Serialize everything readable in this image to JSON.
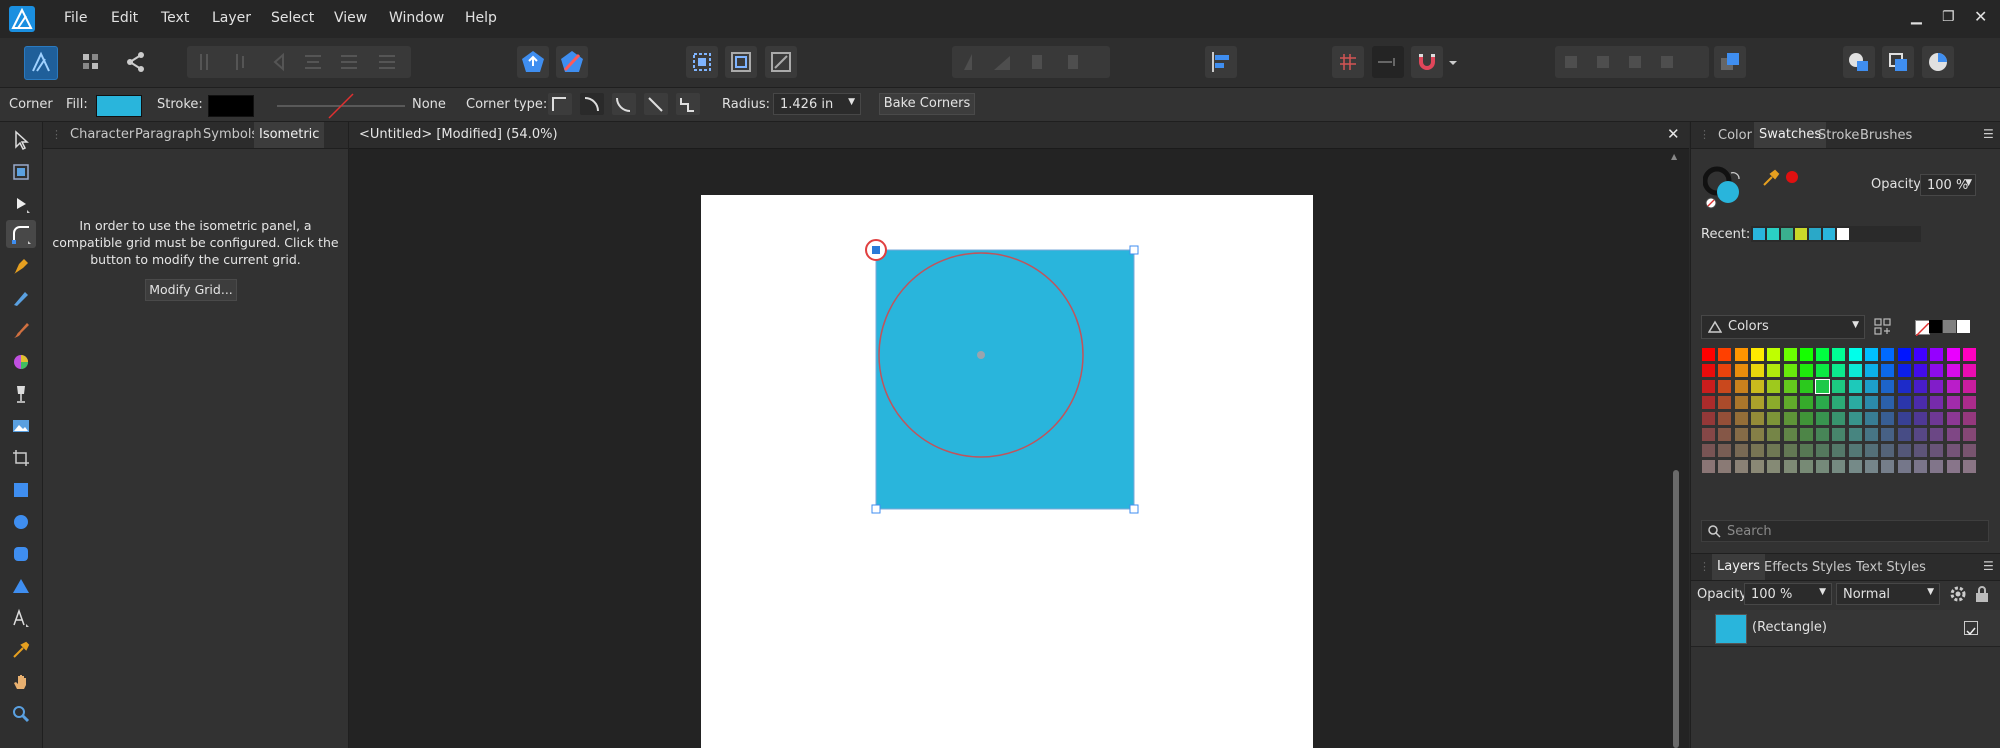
{
  "menu": [
    "File",
    "Edit",
    "Text",
    "Layer",
    "Select",
    "View",
    "Window",
    "Help"
  ],
  "context_bar": {
    "tool_label": "Corner",
    "fill_label": "Fill:",
    "stroke_label": "Stroke:",
    "stroke_value": "None",
    "corner_type_label": "Corner type:",
    "radius_label": "Radius:",
    "radius_value": "1.426 in",
    "bake_button": "Bake Corners",
    "fill_color": "#29b5dc",
    "stroke_color": "#000000"
  },
  "left_panel": {
    "tabs": [
      "Character",
      "Paragraph",
      "Symbols",
      "Isometric"
    ],
    "active_tab": "Isometric",
    "message_line1": "In order to use the isometric panel, a",
    "message_line2": "compatible grid must be configured. Click the",
    "message_line3": "button to modify the current grid.",
    "modify_button": "Modify Grid..."
  },
  "document": {
    "tab_title": "<Untitled> [Modified] (54.0%)",
    "shape_color": "#29b5dc"
  },
  "right_panel": {
    "top_tabs": [
      "Color",
      "Swatches",
      "Stroke",
      "Brushes"
    ],
    "active_top_tab": "Swatches",
    "opacity_label": "Opacity:",
    "opacity_value": "100 %",
    "recent_label": "Recent:",
    "recent_colors": [
      "#29b5dc",
      "#2ad0c4",
      "#3aaf8f",
      "#c8d82a",
      "#2aa8c8",
      "#29b5dc",
      "#ffffff"
    ],
    "palette_name": "Colors",
    "search_placeholder": "Search",
    "bottom_tabs": [
      "Layers",
      "Effects",
      "Styles",
      "Text Styles"
    ],
    "active_bottom_tab": "Layers",
    "layers_opacity_label": "Opacity:",
    "layers_opacity_value": "100 %",
    "blend_mode": "Normal",
    "layer_name": "(Rectangle)"
  }
}
